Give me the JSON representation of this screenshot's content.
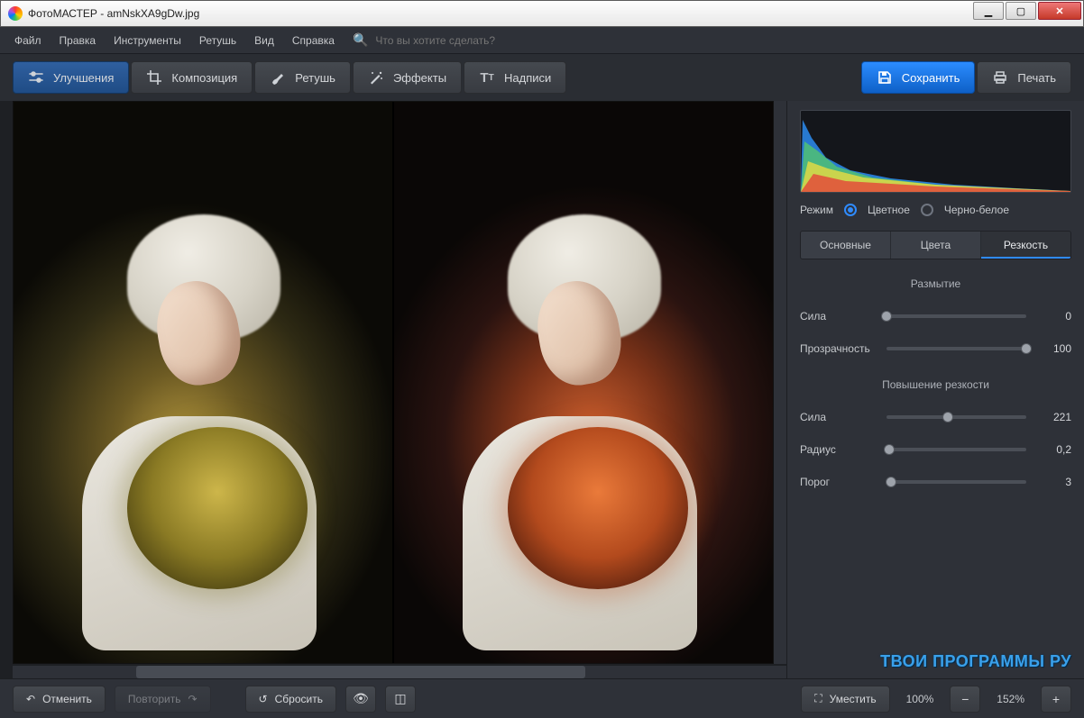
{
  "window": {
    "title": "ФотоМАСТЕР - amNskXA9gDw.jpg"
  },
  "menu": {
    "items": [
      "Файл",
      "Правка",
      "Инструменты",
      "Ретушь",
      "Вид",
      "Справка"
    ],
    "search_placeholder": "Что вы хотите сделать?"
  },
  "toolbar": {
    "enhance": "Улучшения",
    "composition": "Композиция",
    "retouch": "Ретушь",
    "effects": "Эффекты",
    "captions": "Надписи",
    "save": "Сохранить",
    "print": "Печать"
  },
  "panel": {
    "mode_label": "Режим",
    "mode_color": "Цветное",
    "mode_bw": "Черно-белое",
    "tabs": {
      "basic": "Основные",
      "colors": "Цвета",
      "sharpness": "Резкость"
    },
    "section_blur": "Размытие",
    "section_sharpen": "Повышение резкости",
    "sliders": {
      "blur_strength": {
        "label": "Сила",
        "value": "0",
        "pos": 0
      },
      "blur_opacity": {
        "label": "Прозрачность",
        "value": "100",
        "pos": 100
      },
      "sharp_strength": {
        "label": "Сила",
        "value": "221",
        "pos": 44
      },
      "sharp_radius": {
        "label": "Радиус",
        "value": "0,2",
        "pos": 2
      },
      "sharp_threshold": {
        "label": "Порог",
        "value": "3",
        "pos": 3
      }
    }
  },
  "bottom": {
    "undo": "Отменить",
    "redo": "Повторить",
    "reset": "Сбросить",
    "fit": "Уместить",
    "zoom100": "100%",
    "zoom_current": "152%"
  },
  "watermark": "ТВОИ ПРОГРАММЫ РУ"
}
